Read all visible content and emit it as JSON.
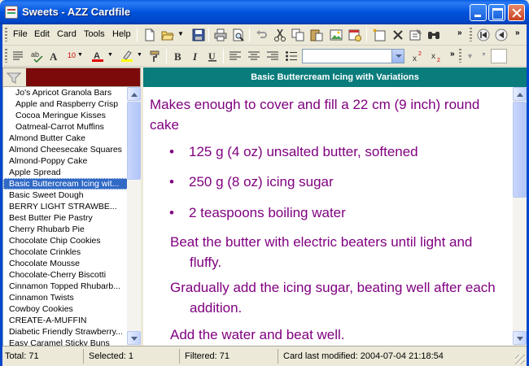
{
  "window": {
    "title": "Sweets - AZZ Cardfile"
  },
  "menu": [
    {
      "label": "File"
    },
    {
      "label": "Edit"
    },
    {
      "label": "Card"
    },
    {
      "label": "Tools"
    },
    {
      "label": "Help"
    }
  ],
  "toolbar2": {
    "font_size": "10",
    "more": "»"
  },
  "toolbar1": {
    "more": "»"
  },
  "card_list": [
    "Jo's Apricot Granola Bars",
    "Apple and Raspberry Crisp",
    "Cocoa Meringue Kisses",
    "Oatmeal-Carrot Muffins",
    "Almond Butter Cake",
    "Almond Cheesecake Squares",
    "Almond-Poppy Cake",
    "Apple Spread",
    "Basic Buttercream Icing wit...",
    "Basic Sweet Dough",
    "BERRY LIGHT STRAWBE...",
    "Best Butter Pie Pastry",
    "Cherry Rhubarb Pie",
    "Chocolate Chip Cookies",
    "Chocolate Crinkles",
    "Chocolate Mousse",
    "Chocolate-Cherry Biscotti",
    "Cinnamon Topped Rhubarb...",
    "Cinnamon Twists",
    "Cowboy Cookies",
    "CREATE-A-MUFFIN",
    "Diabetic Friendly Strawberry...",
    "Easy Caramel Sticky Buns"
  ],
  "card": {
    "title": "Basic Buttercream Icing with Variations",
    "intro": "Makes enough to cover and fill a 22 cm (9 inch) round cake",
    "ingredients": [
      "125 g (4 oz) unsalted butter, softened",
      "250 g (8 oz) icing sugar",
      "2 teaspoons boiling water"
    ],
    "steps": [
      "Beat the butter with electric beaters until light and fluffy.",
      "Gradually add the icing sugar, beating well after each addition.",
      "Add the water and beat well."
    ]
  },
  "status": {
    "total": "Total: 71",
    "selected": "Selected: 1",
    "filtered": "Filtered: 71",
    "modified": "Card last modified: 2004-07-04  21:18:54"
  },
  "colors": {
    "title_bar": "#0053dd",
    "card_header": "#0a7c7c",
    "card_text": "#800080",
    "filter_box": "#7c0a0a",
    "selection": "#316ac5"
  }
}
